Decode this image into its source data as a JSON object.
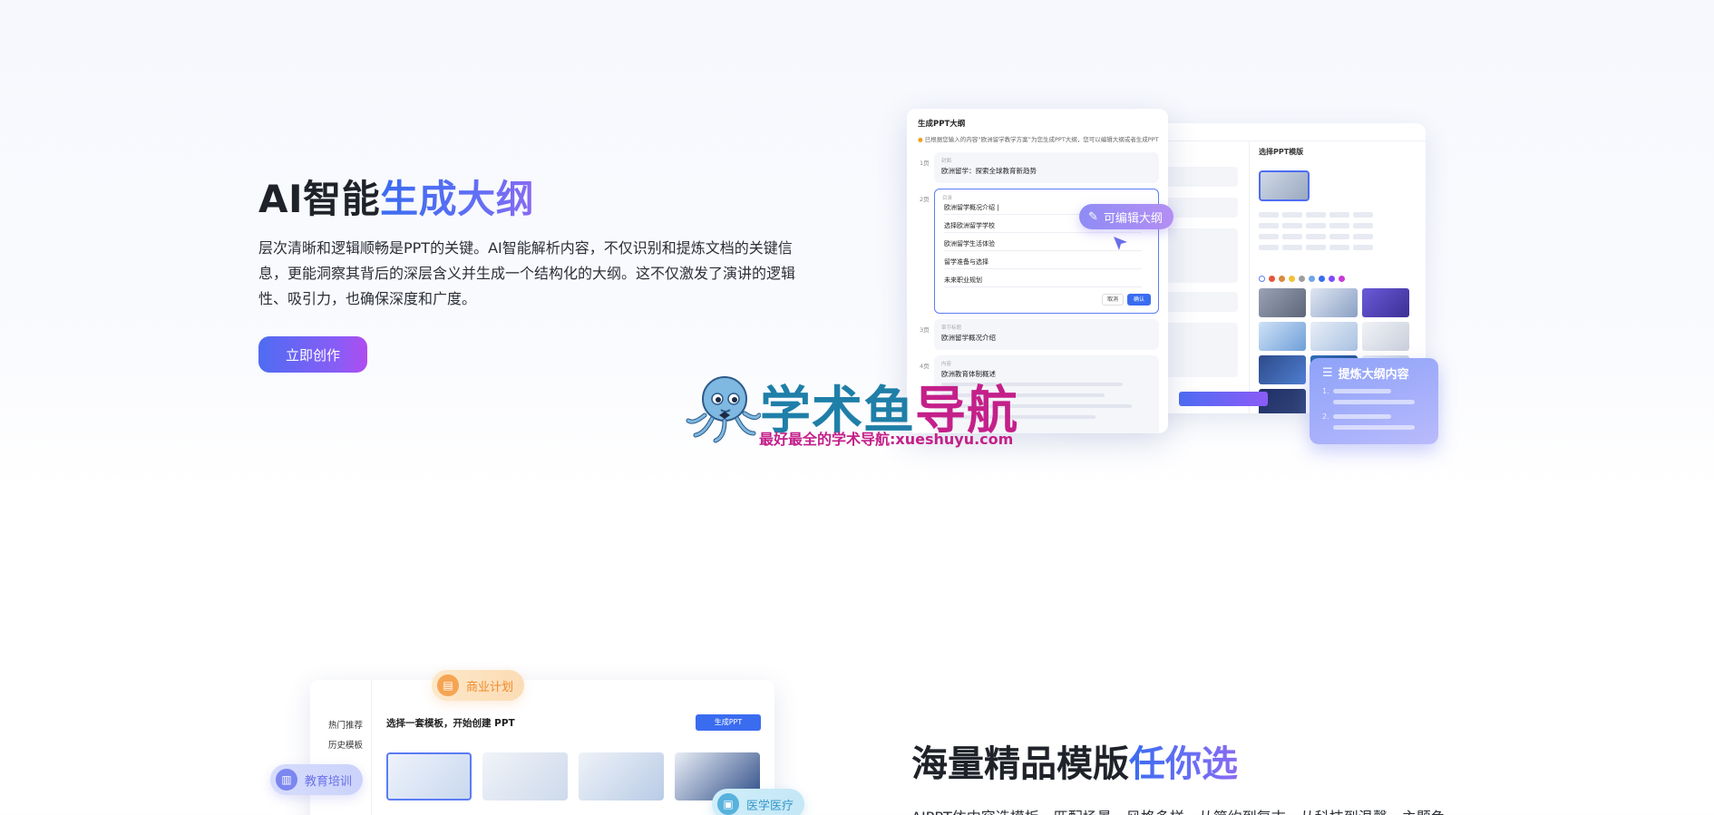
{
  "section1": {
    "title_plain": "AI智能",
    "title_highlight": "生成大纲",
    "description": "层次清晰和逻辑顺畅是PPT的关键。AI智能解析内容，不仅识别和提炼文档的关键信息，更能洞察其背后的深层含义并生成一个结构化的大纲。这不仅激发了演讲的逻辑性、吸引力，也确保深度和广度。",
    "cta_label": "立即创作",
    "mockup": {
      "card_title": "生成PPT大纲",
      "note": "已根据您输入的内容“欧洲留学教学方案”为您生成PPT大纲，您可以编辑大纲或者生成PPT",
      "items": [
        {
          "index": "1页",
          "label": "封面",
          "text": "欧洲留学：探索全球教育新趋势"
        },
        {
          "index": "2页",
          "label": "目录"
        },
        {
          "index": "3页",
          "label": "章节标题",
          "text": "欧洲留学概况介绍"
        },
        {
          "index": "4页",
          "label": "内容",
          "text": "欧洲教育体制概述"
        }
      ],
      "edit_lines": [
        "欧洲留学概况介绍 |",
        "选择欧洲留学学校",
        "欧洲留学生活体验",
        "留学准备与选择",
        "未来职业规划"
      ],
      "cancel_label": "取消",
      "ok_label": "确认",
      "edit_pill_label": "可编辑大纲",
      "template_panel_title": "选择PPT模版",
      "swatch_colors": [
        "#ffffff",
        "#e5533b",
        "#d98a3a",
        "#f1c232",
        "#9e9e9e",
        "#6ea6e8",
        "#3a6cf0",
        "#7c4dff",
        "#c93ad6"
      ],
      "extract_title": "提炼大纲内容",
      "extract_nums": [
        "1.",
        "2."
      ]
    },
    "watermark": {
      "title_a": "学术鱼",
      "title_b": "导航",
      "subtitle_a": "最好最全的学术导航:",
      "subtitle_b": "xueshuyu.com"
    }
  },
  "section2": {
    "title_plain": "海量精品模版",
    "title_highlight": "任你选",
    "description": "AIPPT依内容选模板，匹配场景，风格多样，从简约到复古，从科技到温馨，主题色",
    "template_card": {
      "sidebar": [
        "热门推荐",
        "历史模板"
      ],
      "heading": "选择一套模板，开始创建 PPT",
      "generate_label": "生成PPT"
    },
    "tags": {
      "business": "商业计划",
      "education": "教育培训",
      "medical": "医学医疗"
    }
  }
}
